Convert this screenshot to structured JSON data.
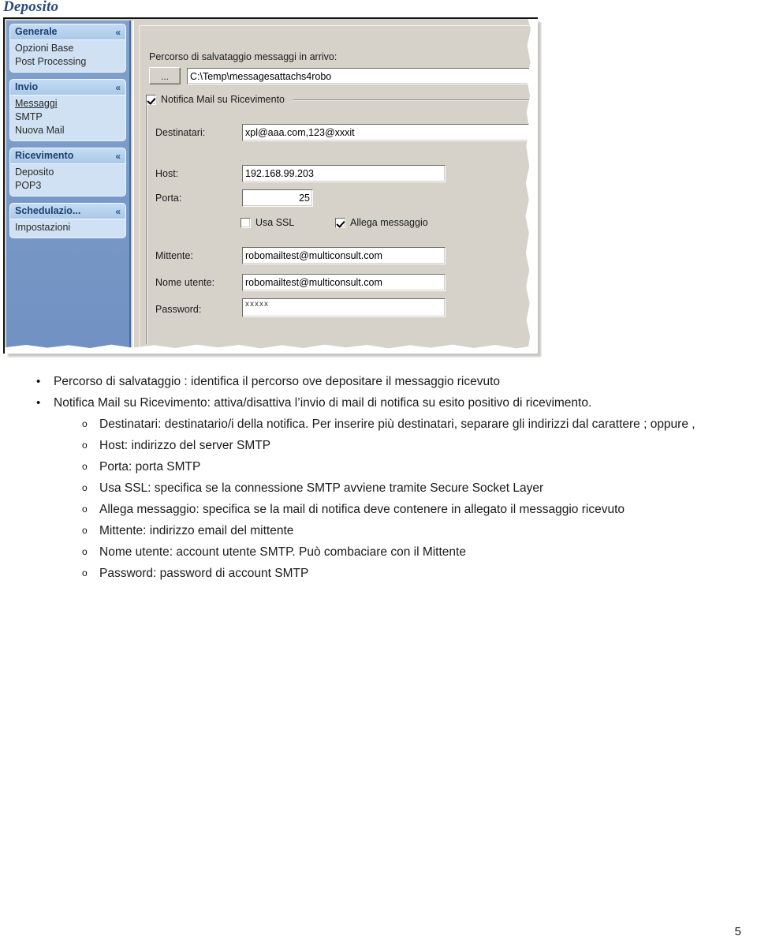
{
  "document": {
    "title": "Deposito",
    "page_number": "5"
  },
  "screenshot": {
    "sidebar": {
      "groups": [
        {
          "header": "Generale",
          "chevron": "chevron-up-icon",
          "items": [
            {
              "label": "Opzioni Base",
              "link": false
            },
            {
              "label": "Post Processing",
              "link": false
            }
          ]
        },
        {
          "header": "Invio",
          "chevron": "chevron-up-icon",
          "items": [
            {
              "label": "Messaggi",
              "link": true
            },
            {
              "label": "SMTP",
              "link": false
            },
            {
              "label": "Nuova Mail",
              "link": false
            }
          ]
        },
        {
          "header": "Ricevimento",
          "chevron": "chevron-up-icon",
          "items": [
            {
              "label": "Deposito",
              "link": false
            },
            {
              "label": "POP3",
              "link": false
            }
          ]
        },
        {
          "header": "Schedulazio...",
          "chevron": "chevron-up-icon",
          "items": [
            {
              "label": "Impostazioni",
              "link": false
            }
          ]
        }
      ]
    },
    "form": {
      "path_label": "Percorso di salvataggio messaggi in arrivo:",
      "browse_button": "...",
      "path_value": "C:\\Temp\\messagesattachs4robo",
      "notify_group_label": "Notifica Mail su Ricevimento",
      "notify_checked": true,
      "recipients_label": "Destinatari:",
      "recipients_value": "xpl@aaa.com,123@xxxit",
      "host_label": "Host:",
      "host_value": "192.168.99.203",
      "port_label": "Porta:",
      "port_value": "25",
      "use_ssl_label": "Usa SSL",
      "use_ssl_checked": false,
      "attach_label": "Allega messaggio",
      "attach_checked": true,
      "sender_label": "Mittente:",
      "sender_value": "robomailtest@multiconsult.com",
      "username_label": "Nome utente:",
      "username_value": "robomailtest@multiconsult.com",
      "password_label": "Password:",
      "password_value": "xxxxx"
    }
  },
  "body": {
    "bullet_filled": "•",
    "bullet_hollow": "o",
    "items": [
      {
        "level": 1,
        "text": "Percorso di salvataggio : identifica il percorso ove depositare il messaggio ricevuto"
      },
      {
        "level": 1,
        "text": "Notifica Mail su Ricevimento: attiva/disattiva l’invio di mail di notifica su esito positivo di ricevimento."
      },
      {
        "level": 2,
        "text": "Destinatari: destinatario/i della notifica.  Per inserire più destinatari, separare gli indirizzi dal carattere ; oppure ,"
      },
      {
        "level": 2,
        "text": "Host: indirizzo del server SMTP"
      },
      {
        "level": 2,
        "text": "Porta: porta SMTP"
      },
      {
        "level": 2,
        "text": "Usa SSL: specifica se la connessione SMTP avviene tramite Secure Socket Layer"
      },
      {
        "level": 2,
        "text": "Allega messaggio: specifica se la mail di notifica deve contenere in allegato il messaggio ricevuto"
      },
      {
        "level": 2,
        "text": "Mittente: indirizzo email del mittente"
      },
      {
        "level": 2,
        "text": "Nome utente:  account utente SMTP.  Può combaciare con il Mittente"
      },
      {
        "level": 2,
        "text": "Password: password di account SMTP"
      }
    ]
  },
  "colors": {
    "title": "#2b4a7d",
    "sidebar_bg": "#7d9dc9",
    "group_header": "#a9c8e8",
    "group_body": "#cfe1f3",
    "panel_bg": "#d6d2ca"
  }
}
